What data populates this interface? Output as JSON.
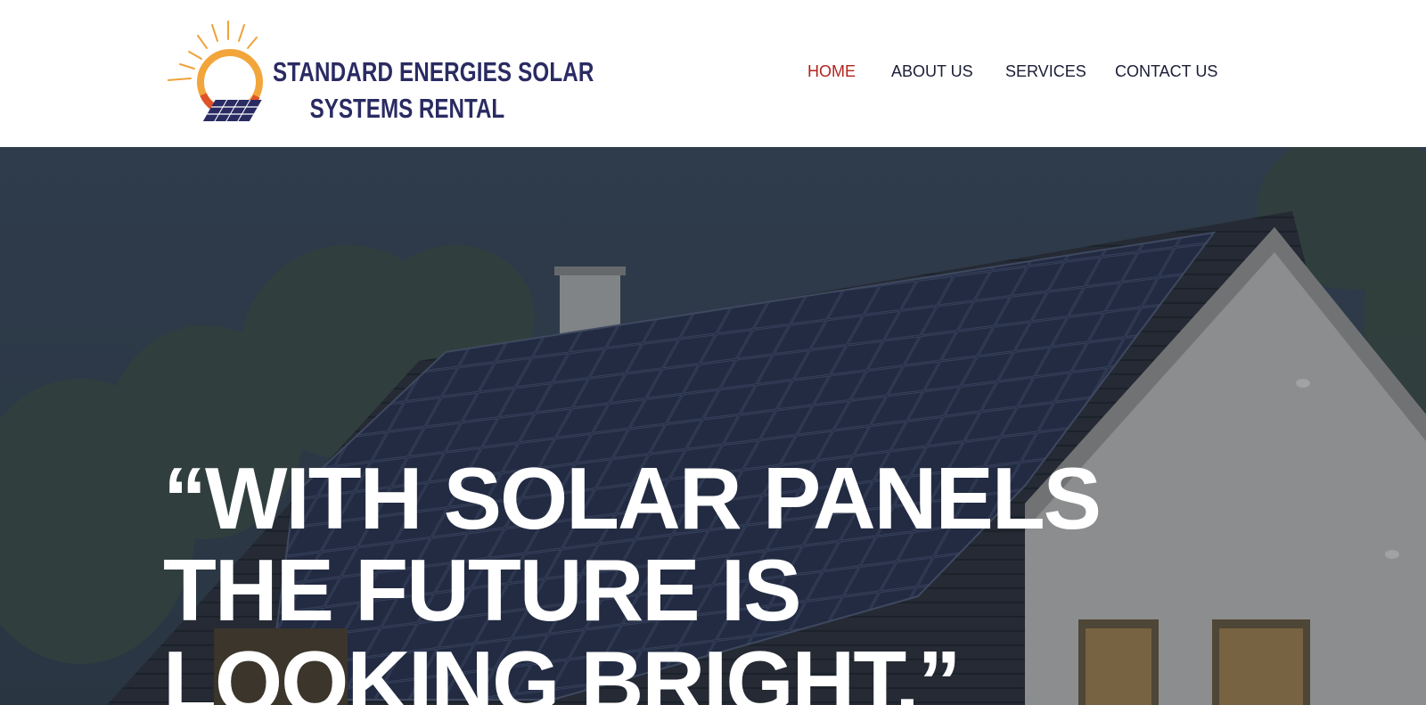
{
  "brand": {
    "name_line1": "STANDARD ENERGIES SOLAR",
    "name_line2": "SYSTEMS RENTAL",
    "colors": {
      "navy": "#2a2b62",
      "sun_orange": "#f0a23a",
      "sun_red": "#e0522a"
    }
  },
  "nav": {
    "items": [
      {
        "label": "HOME",
        "active": true
      },
      {
        "label": "ABOUT US",
        "active": false
      },
      {
        "label": "SERVICES",
        "active": false
      },
      {
        "label": "CONTACT US",
        "active": false
      }
    ],
    "active_color": "#b3231e",
    "text_color": "#1a1d36"
  },
  "hero": {
    "headline_line1": "“WITH SOLAR PANELS",
    "headline_line2": "THE FUTURE IS",
    "headline_line3": "LOOKING BRIGHT.”",
    "image": "house-with-solar-panels-photo"
  }
}
